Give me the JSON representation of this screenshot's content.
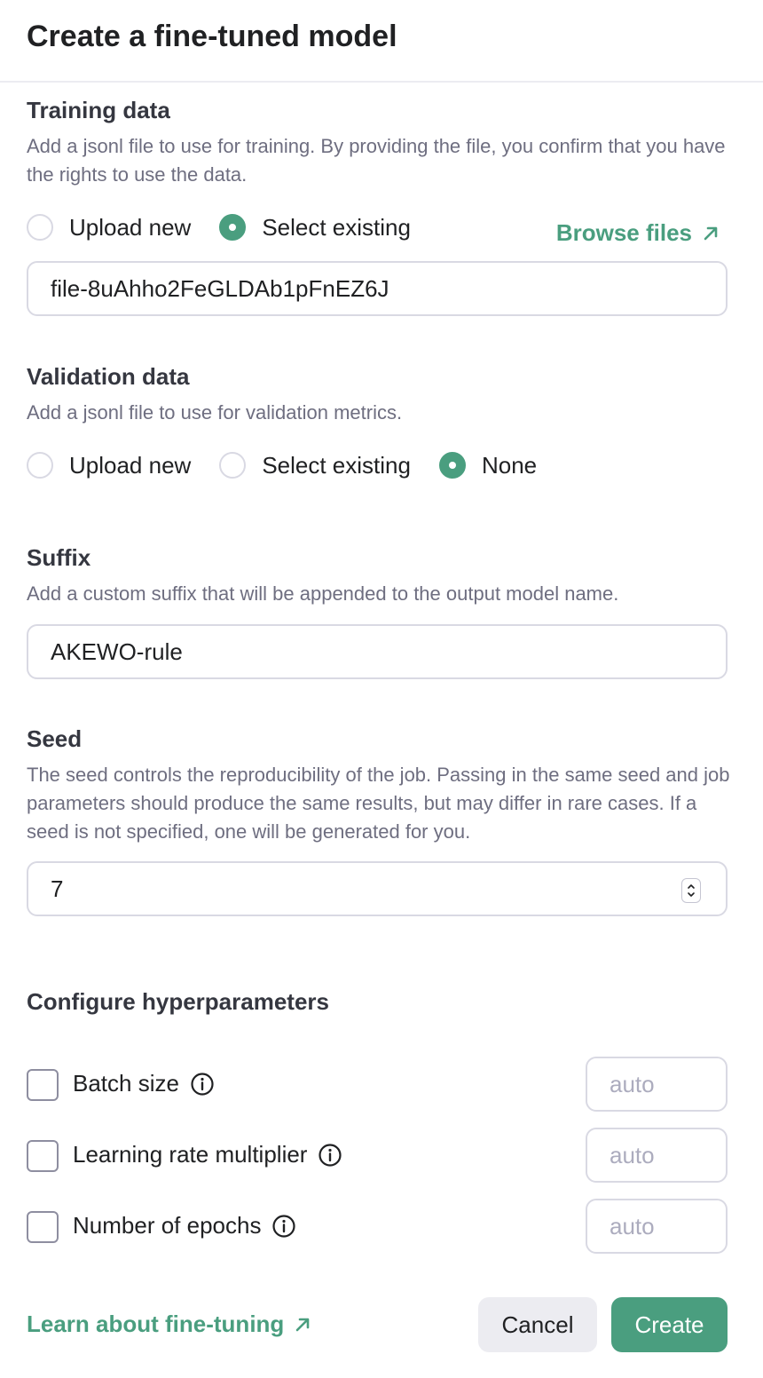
{
  "dialog": {
    "title": "Create a fine-tuned model"
  },
  "training": {
    "title": "Training data",
    "description": "Add a jsonl file to use for training. By providing the file, you confirm that you have the rights to use the data.",
    "options": [
      "Upload new",
      "Select existing"
    ],
    "selected": "Select existing",
    "browse_label": "Browse files",
    "file_value": "file-8uAhho2FeGLDAb1pFnEZ6J"
  },
  "validation": {
    "title": "Validation data",
    "description": "Add a jsonl file to use for validation metrics.",
    "options": [
      "Upload new",
      "Select existing",
      "None"
    ],
    "selected": "None"
  },
  "suffix": {
    "title": "Suffix",
    "description": "Add a custom suffix that will be appended to the output model name.",
    "value": "AKEWO-rule"
  },
  "seed": {
    "title": "Seed",
    "description": "The seed controls the reproducibility of the job. Passing in the same seed and job parameters should produce the same results, but may differ in rare cases. If a seed is not specified, one will be generated for you.",
    "value": "7"
  },
  "hyperparameters": {
    "title": "Configure hyperparameters",
    "items": [
      {
        "label": "Batch size",
        "placeholder": "auto",
        "checked": false
      },
      {
        "label": "Learning rate multiplier",
        "placeholder": "auto",
        "checked": false
      },
      {
        "label": "Number of epochs",
        "placeholder": "auto",
        "checked": false
      }
    ]
  },
  "footer": {
    "learn_link": "Learn about fine-tuning",
    "cancel_label": "Cancel",
    "create_label": "Create"
  },
  "colors": {
    "accent": "#4a9e7f",
    "text": "#202123",
    "muted": "#6e6e80",
    "border": "#d9d9e3"
  },
  "icons": [
    "arrow-up-right-icon",
    "info-icon",
    "stepper-icon"
  ]
}
